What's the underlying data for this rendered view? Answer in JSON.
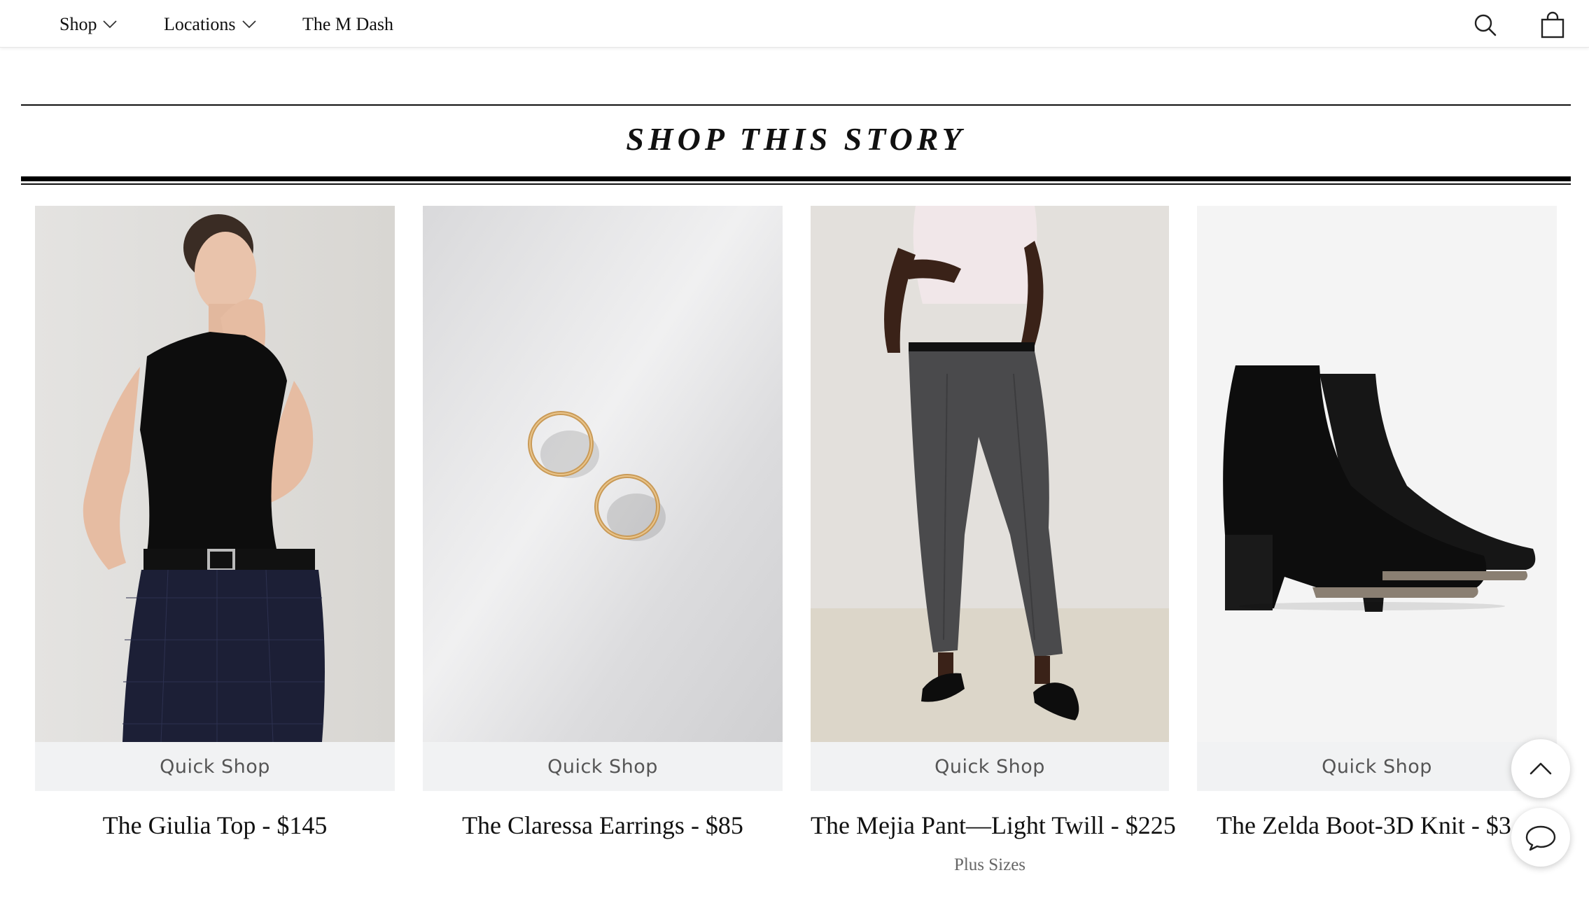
{
  "nav": {
    "items": [
      {
        "label": "Shop",
        "has_dropdown": true
      },
      {
        "label": "Locations",
        "has_dropdown": true
      },
      {
        "label": "The M Dash",
        "has_dropdown": false
      }
    ],
    "icons": [
      "search-icon",
      "shopping-bag-icon"
    ]
  },
  "story": {
    "title": "SHOP THIS STORY"
  },
  "products": [
    {
      "quick_shop": "Quick Shop",
      "name": "The Giulia Top - $145",
      "sub": ""
    },
    {
      "quick_shop": "Quick Shop",
      "name": "The Claressa Earrings - $85",
      "sub": ""
    },
    {
      "quick_shop": "Quick Shop",
      "name": "The Mejia Pant—Light Twill - $225",
      "sub": "Plus Sizes"
    },
    {
      "quick_shop": "Quick Shop",
      "name": "The Zelda Boot-3D Knit - $3",
      "sub": ""
    }
  ],
  "floating": {
    "icons": [
      "chevron-up-icon",
      "chat-bubble-icon"
    ]
  },
  "colors": {
    "text": "#111111",
    "quick_shop_bg": "#f1f2f3",
    "quick_shop_text": "#555555",
    "sub_text": "#666666"
  }
}
